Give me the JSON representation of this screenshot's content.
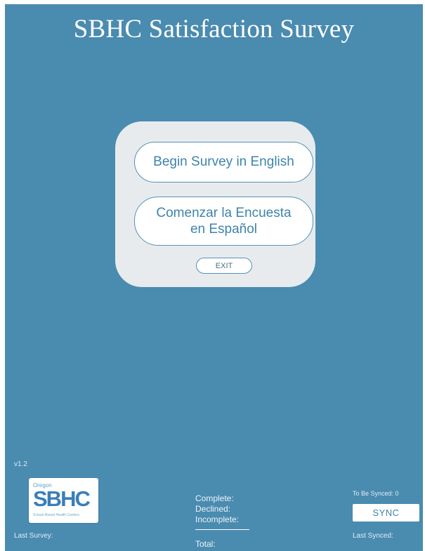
{
  "header": {
    "title": "SBHC Satisfaction Survey"
  },
  "menu": {
    "english_label": "Begin Survey in English",
    "spanish_label": "Comenzar la Encuesta en Español",
    "exit_label": "EXIT"
  },
  "footer": {
    "version": "v1.2",
    "logo": {
      "oregon": "Oregon",
      "text": "SBHC",
      "subtitle": "School-Based Health Centers"
    },
    "last_survey_label": "Last Survey:",
    "stats": {
      "complete_label": "Complete:",
      "declined_label": "Declined:",
      "incomplete_label": "Incomplete:",
      "total_label": "Total:"
    },
    "to_be_synced": "To Be Synced: 0",
    "sync_label": "SYNC",
    "last_synced_label": "Last Synced:"
  },
  "colors": {
    "background": "#4a8bb0",
    "panel": "#e8ebee",
    "button_text": "#3e84ab"
  }
}
